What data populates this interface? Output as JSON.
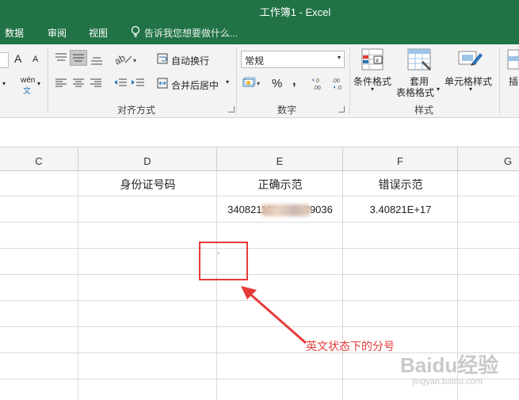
{
  "window": {
    "title": "工作簿1 - Excel"
  },
  "tabs": [
    {
      "label": "数据"
    },
    {
      "label": "审阅"
    },
    {
      "label": "视图"
    }
  ],
  "tell_me": {
    "text": "告诉我您想要做什么..."
  },
  "ribbon": {
    "font": {
      "grow": "A",
      "shrink": "A",
      "phonetic_top": "wén",
      "phonetic_bottom": "文"
    },
    "alignment": {
      "wrap_text": "自动换行",
      "merge_center": "合并后居中",
      "group_label": "对齐方式"
    },
    "number": {
      "format": "常规",
      "percent": "%",
      "comma": ",",
      "inc_dec": ".0\n.00",
      "dec_dec": ".00\n→.0",
      "group_label": "数字"
    },
    "styles": {
      "conditional": "条件格式",
      "table_line1": "套用",
      "table_line2": "表格格式",
      "cell_styles": "单元格样式",
      "group_label": "样式"
    },
    "insert": {
      "label": "插"
    }
  },
  "sheet": {
    "columns": [
      "C",
      "D",
      "E",
      "F",
      "G"
    ],
    "headers": {
      "d": "身份证号码",
      "e": "正确示范",
      "f": "错误示范"
    },
    "row1": {
      "e": "340821123         89036",
      "f": "3.40821E+17"
    },
    "semicolon_cell": "'"
  },
  "annotation": {
    "text": "英文状态下的分号",
    "color": "#e53b3b"
  },
  "watermark": {
    "text": "Baidu经验",
    "sub": "jingyan.baidu.com"
  },
  "colors": {
    "excel_green": "#217346",
    "ribbon_bg": "#f3f3f3",
    "grid": "#dadada"
  }
}
